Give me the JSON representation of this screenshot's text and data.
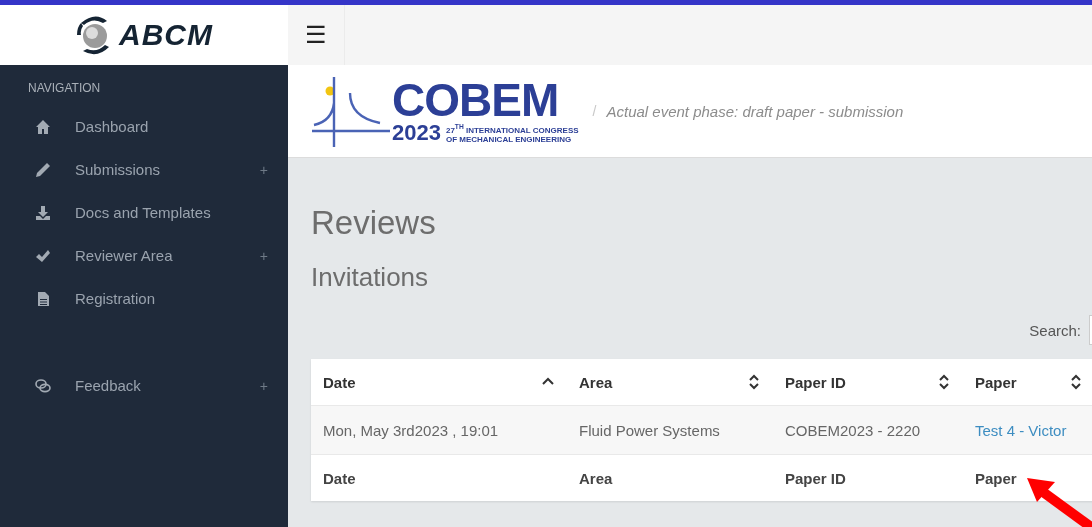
{
  "brand": {
    "logo_text": "ABCM"
  },
  "topbar": {
    "menu_glyph": "☰"
  },
  "sidebar": {
    "heading": "NAVIGATION",
    "sections": [
      {
        "items": [
          {
            "label": "Dashboard"
          },
          {
            "label": "Submissions",
            "toggle": "+"
          },
          {
            "label": "Docs and Templates"
          },
          {
            "label": "Reviewer Area",
            "toggle": "+"
          },
          {
            "label": "Registration"
          }
        ]
      },
      {
        "items": [
          {
            "label": "Feedback",
            "toggle": "+"
          }
        ]
      }
    ]
  },
  "event_banner": {
    "logo_word": "COBEM",
    "logo_year": "2023",
    "logo_caption_1": "27$^{TH}$ INTERNATIONAL CONGRESS",
    "logo_caption_2": "OF MECHANICAL ENGINEERING",
    "separator": "/",
    "phase": "Actual event phase: draft paper - submission"
  },
  "page": {
    "title": "Reviews",
    "subtitle": "Invitations",
    "search_label": "Search:"
  },
  "table": {
    "columns": [
      {
        "label": "Date",
        "sorted": true
      },
      {
        "label": "Area",
        "sorted": false
      },
      {
        "label": "Paper ID",
        "sorted": false
      },
      {
        "label": "Paper",
        "sorted": false
      }
    ],
    "rows": [
      {
        "cells": [
          "Mon, May 3rd2023 , 19:01",
          "Fluid Power Systems",
          "COBEM2023 - 2220",
          "Test 4 - Victor"
        ]
      }
    ],
    "footer": [
      "Date",
      "Area",
      "Paper ID",
      "Paper"
    ]
  }
}
